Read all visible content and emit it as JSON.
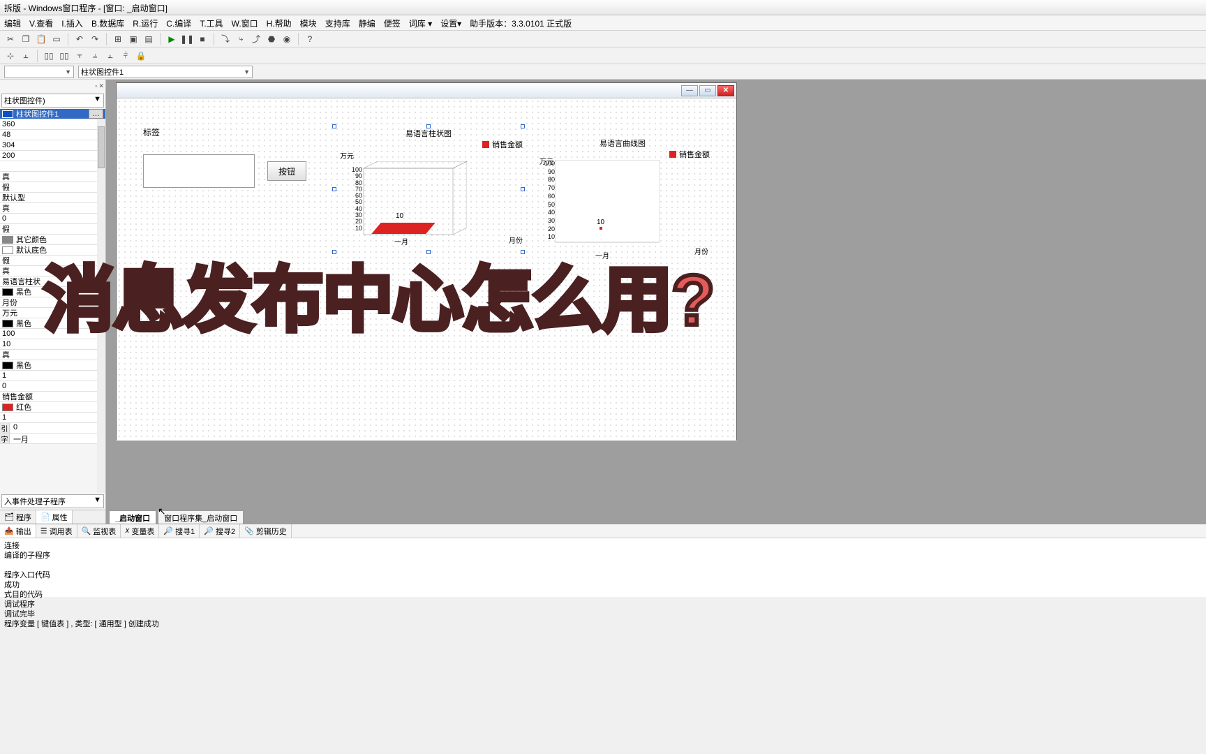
{
  "title": "拆版 - Windows窗口程序 - [窗口: _启动窗口]",
  "menu": [
    "编辑",
    "V.查看",
    "I.插入",
    "B.数据库",
    "R.运行",
    "C.编译",
    "T.工具",
    "W.窗口",
    "H.帮助",
    "模块",
    "支持库",
    "静编",
    "便签",
    "词库 ▾",
    "设置▾",
    "助手版本：3.3.0101 正式版"
  ],
  "combo1": "",
  "combo2": "柱状图控件1",
  "sidebar_top_combo": "柱状图控件)",
  "sidebar_item_sel": "柱状图控件1",
  "props": [
    "360",
    "48",
    "304",
    "200",
    "",
    "真",
    "假",
    "默认型",
    "真",
    "0",
    "假"
  ],
  "color_props": [
    {
      "label": "其它颜色",
      "color": "#888"
    },
    {
      "label": "默认底色",
      "color": ""
    }
  ],
  "props2": [
    "假",
    "真",
    "易语言柱状"
  ],
  "color_props2": [
    {
      "label": "黑色",
      "color": "#000"
    }
  ],
  "props3": [
    "月份",
    "万元"
  ],
  "color_props3": [
    {
      "label": "黑色",
      "color": "#000"
    }
  ],
  "props4": [
    "100",
    "10",
    "真"
  ],
  "color_props4": [
    {
      "label": "黑色",
      "color": "#000"
    }
  ],
  "props5": [
    "1",
    "0",
    "销售金额"
  ],
  "color_props5": [
    {
      "label": "红色",
      "color": "#d22"
    }
  ],
  "props6": [
    "1"
  ],
  "props_lbl": [
    {
      "k": "引",
      "v": "0"
    },
    {
      "k": "字",
      "v": "一月"
    }
  ],
  "event_combo": "入事件处理子程序",
  "side_tabs": [
    "程序",
    "属性"
  ],
  "form": {
    "label": "标签",
    "button": "按钮",
    "chart1_title": "易语言柱状图",
    "chart2_title": "易语言曲线图",
    "legend": "销售金额",
    "ylab": "万元",
    "xlab": "月份",
    "xcat": "一月",
    "datalabel": "10"
  },
  "chart_data": [
    {
      "type": "bar",
      "title": "易语言柱状图",
      "xlabel": "月份",
      "ylabel": "万元",
      "ylim": [
        0,
        100
      ],
      "categories": [
        "一月"
      ],
      "series": [
        {
          "name": "销售金额",
          "values": [
            10
          ]
        }
      ]
    },
    {
      "type": "line",
      "title": "易语言曲线图",
      "xlabel": "月份",
      "ylabel": "万元",
      "ylim": [
        0,
        100
      ],
      "categories": [
        "一月"
      ],
      "series": [
        {
          "name": "销售金额",
          "values": [
            10
          ]
        }
      ]
    }
  ],
  "canvas_tabs": [
    "_启动窗口",
    "窗口程序集_启动窗口"
  ],
  "bottom_tabs": [
    "输出",
    "调用表",
    "监视表",
    "变量表",
    "搜寻1",
    "搜寻2",
    "剪辑历史"
  ],
  "output_lines": [
    "连接",
    "编译的子程序",
    "",
    "程序入口代码",
    "成功",
    "式目的代码",
    "调试程序",
    "调试完毕",
    "程序变量 [ 键值表 ] , 类型: [ 通用型 ] 创建成功"
  ],
  "overlay": "消息发布中心怎么用?"
}
